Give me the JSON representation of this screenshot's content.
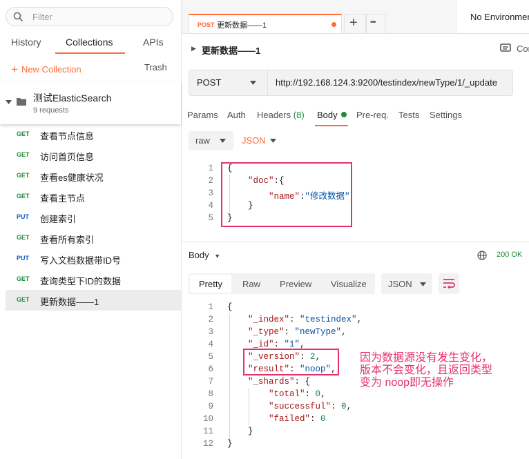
{
  "sidebar": {
    "search_placeholder": "Filter",
    "tabs": {
      "history": "History",
      "collections": "Collections",
      "apis": "APIs"
    },
    "new_collection": "New Collection",
    "new_collection_icon": "+",
    "trash": "Trash",
    "collection": {
      "name": "测试ElasticSearch",
      "count": "9 requests"
    },
    "requests": [
      {
        "method": "GET",
        "name": "查看节点信息"
      },
      {
        "method": "GET",
        "name": "访问首页信息"
      },
      {
        "method": "GET",
        "name": "查看es健康状况"
      },
      {
        "method": "GET",
        "name": "查看主节点"
      },
      {
        "method": "PUT",
        "name": "创建索引"
      },
      {
        "method": "GET",
        "name": "查看所有索引"
      },
      {
        "method": "PUT",
        "name": "写入文档数据带ID号"
      },
      {
        "method": "GET",
        "name": "查询类型下ID的数据"
      },
      {
        "method": "GET",
        "name": "更新数据——1"
      }
    ]
  },
  "tabbar": {
    "method": "POST",
    "name": "更新数据——1",
    "add": "+",
    "more": "•••"
  },
  "environment": "No Environment",
  "request": {
    "title": "更新数据——1",
    "comments": "Comments",
    "method": "POST",
    "url": "http://192.168.124.3:9200/testindex/newType/1/_update",
    "tabs": [
      "Params",
      "Auth",
      "Headers",
      "Body",
      "Pre-req.",
      "Tests",
      "Settings"
    ],
    "headers_count": "(8)",
    "body_mode": "raw",
    "body_format": "JSON",
    "body_lines": [
      {
        "n": "1",
        "text": "{"
      },
      {
        "n": "2",
        "text": "    \"doc\":{"
      },
      {
        "n": "3",
        "text": "        \"name\":\"修改数据\""
      },
      {
        "n": "4",
        "text": "    }"
      },
      {
        "n": "5",
        "text": "}"
      }
    ]
  },
  "response": {
    "title": "Body",
    "status": "200 OK",
    "views": [
      "Pretty",
      "Raw",
      "Preview",
      "Visualize"
    ],
    "format": "JSON",
    "lines": [
      {
        "n": "1",
        "text": "{"
      },
      {
        "n": "2",
        "text": "    \"_index\": \"testindex\","
      },
      {
        "n": "3",
        "text": "    \"_type\": \"newType\","
      },
      {
        "n": "4",
        "text": "    \"_id\": \"1\","
      },
      {
        "n": "5",
        "text": "    \"_version\": 2,"
      },
      {
        "n": "6",
        "text": "    \"result\": \"noop\","
      },
      {
        "n": "7",
        "text": "    \"_shards\": {"
      },
      {
        "n": "8",
        "text": "        \"total\": 0,"
      },
      {
        "n": "9",
        "text": "        \"successful\": 0,"
      },
      {
        "n": "10",
        "text": "        \"failed\": 0"
      },
      {
        "n": "11",
        "text": "    }"
      },
      {
        "n": "12",
        "text": "}"
      }
    ]
  },
  "annotation": [
    "因为数据源没有发生变化，",
    "版本不会变化，且返回类型",
    "变为 noop即无操作"
  ],
  "colors": {
    "accent": "#ff6c37",
    "get": "#1f8c3a",
    "put": "#0e5ec7",
    "highlight": "#e5306e"
  }
}
